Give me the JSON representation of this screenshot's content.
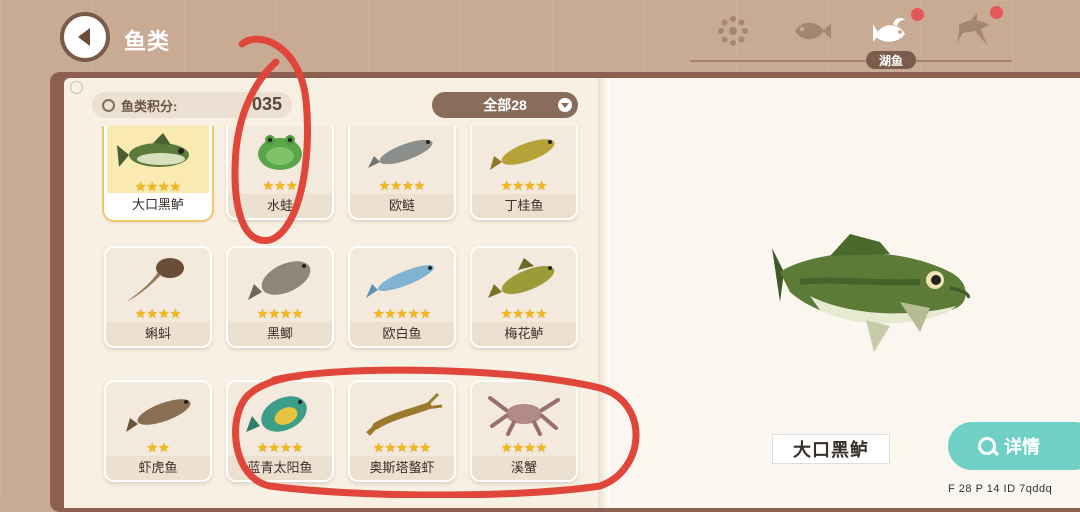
{
  "header": {
    "title": "鱼类",
    "tabs": [
      {
        "icon": "flower-icon",
        "label": ""
      },
      {
        "icon": "fish-icon",
        "label": ""
      },
      {
        "icon": "lake-fish-icon",
        "label": "湖鱼",
        "active": true,
        "badge": true
      },
      {
        "icon": "shark-icon",
        "label": "",
        "badge": true
      }
    ]
  },
  "score": {
    "label": "鱼类积分:",
    "value": "035"
  },
  "filter": {
    "label": "全部28"
  },
  "fish": [
    {
      "name": "大口黑鲈",
      "stars": "★★★★",
      "selected": true
    },
    {
      "name": "水蛙",
      "stars": "★★★"
    },
    {
      "name": "欧鲢",
      "stars": "★★★★"
    },
    {
      "name": "丁桂鱼",
      "stars": "★★★★"
    },
    {
      "name": "蝌蚪",
      "stars": "★★★★"
    },
    {
      "name": "黑鲫",
      "stars": "★★★★"
    },
    {
      "name": "欧白鱼",
      "stars": "★★★★★"
    },
    {
      "name": "梅花鲈",
      "stars": "★★★★"
    },
    {
      "name": "虾虎鱼",
      "stars": "★★"
    },
    {
      "name": "蓝青太阳鱼",
      "stars": "★★★★"
    },
    {
      "name": "奥斯塔螯虾",
      "stars": "★★★★★"
    },
    {
      "name": "溪蟹",
      "stars": "★★★★"
    }
  ],
  "detail": {
    "selected_name": "大口黑鲈",
    "button_label": "详情"
  },
  "footer": "F 28  P 14  ID 7qddq",
  "colors": {
    "accent": "#6fd0c5",
    "star": "#f1b91c",
    "badge": "#e4575a",
    "annotation": "#e0463a"
  }
}
